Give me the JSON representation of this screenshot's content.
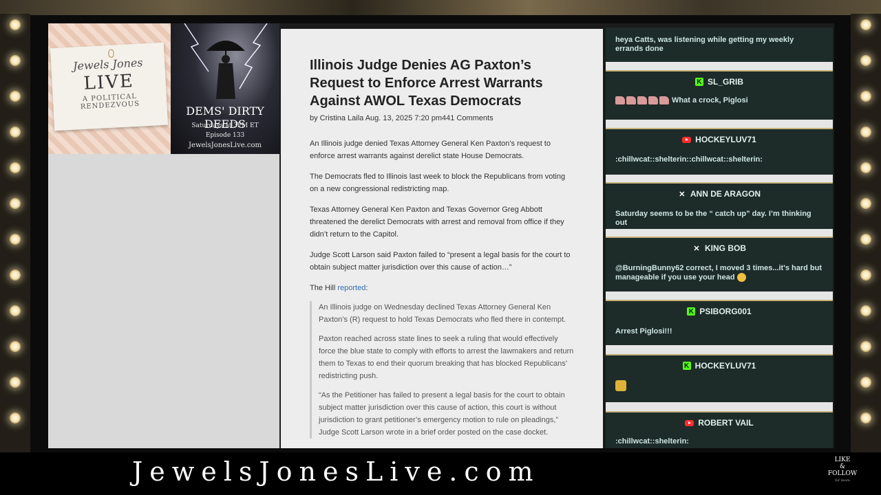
{
  "promo": {
    "title": "Jewels Jones",
    "live": "LIVE",
    "subtitle": "A POLITICAL RENDEZVOUS",
    "show_title": "DEMS' DIRTY DEEDS",
    "schedule": "Saturdays at 3PM ET",
    "episode": "Episode 133",
    "site": "JewelsJonesLive.com"
  },
  "article": {
    "headline": "Illinois Judge Denies AG Paxton’s Request to Enforce Arrest Warrants Against AWOL Texas Democrats",
    "byline": "by Cristina Laila Aug. 13, 2025 7:20 pm441 Comments",
    "p1": "An Illinois judge denied Texas Attorney General Ken Paxton’s request to enforce arrest warrants against derelict state House Democrats.",
    "p2": "The Democrats fled to Illinois last week to block the Republicans from voting on a new congressional redistricting map.",
    "p3": "Texas Attorney General Ken Paxton and Texas Governor Greg Abbott threatened the derelict Democrats with arrest and removal from office if they didn’t return to the Capitol.",
    "p4": "Judge Scott Larson said Paxton failed to “present a legal basis for the court to obtain subject matter jurisdiction over this cause of action…”",
    "source_prefix": "The Hill ",
    "source_link": "reported",
    "source_suffix": ":",
    "q1": "An Illinois judge on Wednesday declined Texas Attorney General Ken Paxton’s (R) request to hold Texas Democrats who fled there in contempt.",
    "q2": "Paxton reached across state lines to seek a ruling that would effectively force the blue state to comply with efforts to arrest the lawmakers and return them to Texas to end their quorum breaking that has blocked Republicans’ redistricting push.",
    "q3": "“As the Petitioner has failed to present a legal basis for the court to obtain subject matter jurisdiction over this cause of action, this court is without jurisdiction to grant petitioner’s emergency motion to rule on pleadings,” Judge Scott Larson wrote in a brief order posted on the case docket."
  },
  "chat": {
    "top_message": "heya Catts, was listening while getting my weekly errands done",
    "messages": [
      {
        "platform": "kick",
        "user": "SL_GRIB",
        "text": "What a crock, Piglosi"
      },
      {
        "platform": "youtube",
        "user": "HOCKEYLUV71",
        "text": ":chillwcat::shelterin::chillwcat::shelterin:"
      },
      {
        "platform": "x",
        "user": "ANN DE ARAGON",
        "text": "Saturday seems to be the “ catch up” day. I’m thinking out"
      },
      {
        "platform": "x",
        "user": "KING BOB",
        "text": "@BurningBunny62 correct, I moved 3 times...it's hard but manageable if you use your head"
      },
      {
        "platform": "kick",
        "user": "PSIBORG001",
        "text": "Arrest Piglosi!!!"
      },
      {
        "platform": "kick",
        "user": "HOCKEYLUV71",
        "text": ""
      },
      {
        "platform": "youtube",
        "user": "ROBERT VAIL",
        "text": ":chillwcat::shelterin:"
      }
    ]
  },
  "footer": {
    "site_title": "JewelsJonesLive.com",
    "like": "LIKE",
    "amp": "&",
    "follow": "FOLLOW",
    "for_more": "for more"
  }
}
